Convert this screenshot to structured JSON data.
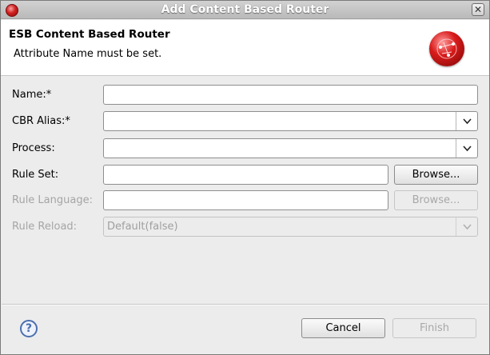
{
  "window": {
    "title": "Add Content Based Router",
    "close_glyph": "✕"
  },
  "header": {
    "title": "ESB Content Based Router",
    "message": "Attribute Name must be set.",
    "logo_icon": "esb-router-sphere-icon"
  },
  "form": {
    "name": {
      "label": "Name:*",
      "value": ""
    },
    "cbr_alias": {
      "label": "CBR Alias:*",
      "value": ""
    },
    "process": {
      "label": "Process:",
      "value": ""
    },
    "rule_set": {
      "label": "Rule Set:",
      "value": "",
      "browse_label": "Browse..."
    },
    "rule_language": {
      "label": "Rule Language:",
      "value": "",
      "browse_label": "Browse..."
    },
    "rule_reload": {
      "label": "Rule Reload:",
      "value": "Default(false)"
    }
  },
  "footer": {
    "help_glyph": "?",
    "cancel_label": "Cancel",
    "finish_label": "Finish"
  },
  "colors": {
    "accent_red": "#d12020",
    "help_blue": "#4b6fae",
    "disabled_text": "#a5a5a5"
  }
}
